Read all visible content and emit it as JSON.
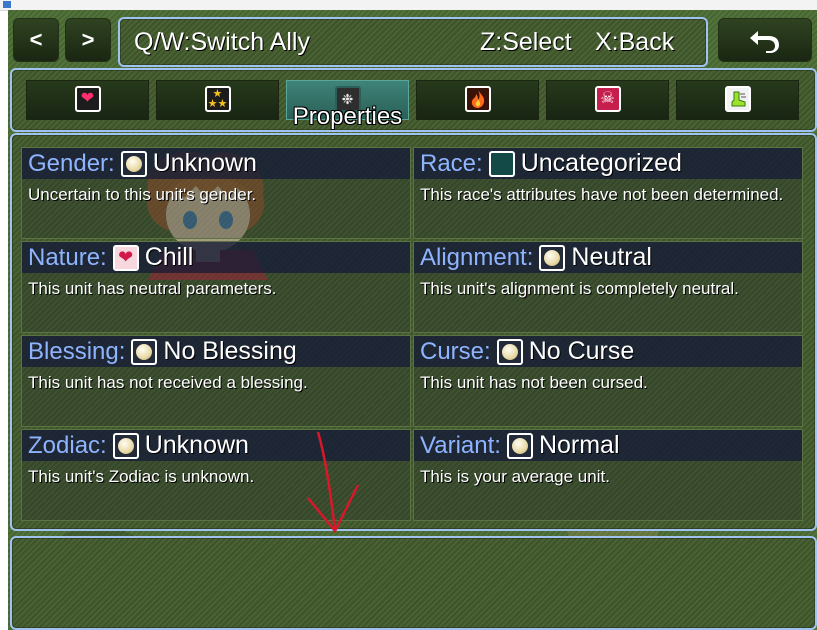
{
  "nav": {
    "prev_label": "<",
    "next_label": ">",
    "back_icon": "undo-arrow-icon"
  },
  "hints": {
    "switch": "Q/W:Switch Ally",
    "select": "Z:Select",
    "back": "X:Back"
  },
  "tabs": [
    {
      "icon": "heart-icon",
      "label": ""
    },
    {
      "icon": "stars-icon",
      "label": ""
    },
    {
      "icon": "properties-icon",
      "label": "Properties",
      "active": true
    },
    {
      "icon": "fire-icon",
      "label": ""
    },
    {
      "icon": "skull-icon",
      "label": ""
    },
    {
      "icon": "boot-icon",
      "label": ""
    }
  ],
  "properties": [
    {
      "title": "Gender:",
      "icon": "orb-icon",
      "value": "Unknown",
      "desc": "Uncertain to this unit's gender."
    },
    {
      "title": "Race:",
      "icon": "teal-square-icon",
      "value": "Uncategorized",
      "desc": "This race's attributes have not been determined."
    },
    {
      "title": "Nature:",
      "icon": "heart-icon",
      "value": "Chill",
      "desc": "This unit has neutral parameters."
    },
    {
      "title": "Alignment:",
      "icon": "orb-icon",
      "value": "Neutral",
      "desc": "This unit's alignment is completely neutral."
    },
    {
      "title": "Blessing:",
      "icon": "orb-icon",
      "value": "No Blessing",
      "desc": "This unit has not received a blessing."
    },
    {
      "title": "Curse:",
      "icon": "orb-icon",
      "value": "No Curse",
      "desc": "This unit has not been cursed."
    },
    {
      "title": "Zodiac:",
      "icon": "orb-icon",
      "value": "Unknown",
      "desc": "This unit's Zodiac is unknown."
    },
    {
      "title": "Variant:",
      "icon": "orb-icon",
      "value": "Normal",
      "desc": "This is your average unit."
    }
  ],
  "colors": {
    "window_border": "#9fc2ee",
    "window_bg": "#41592b",
    "title_text": "#8fb4ff",
    "active_tab": "#3f8378",
    "annotation_arrow": "#d8182a"
  }
}
